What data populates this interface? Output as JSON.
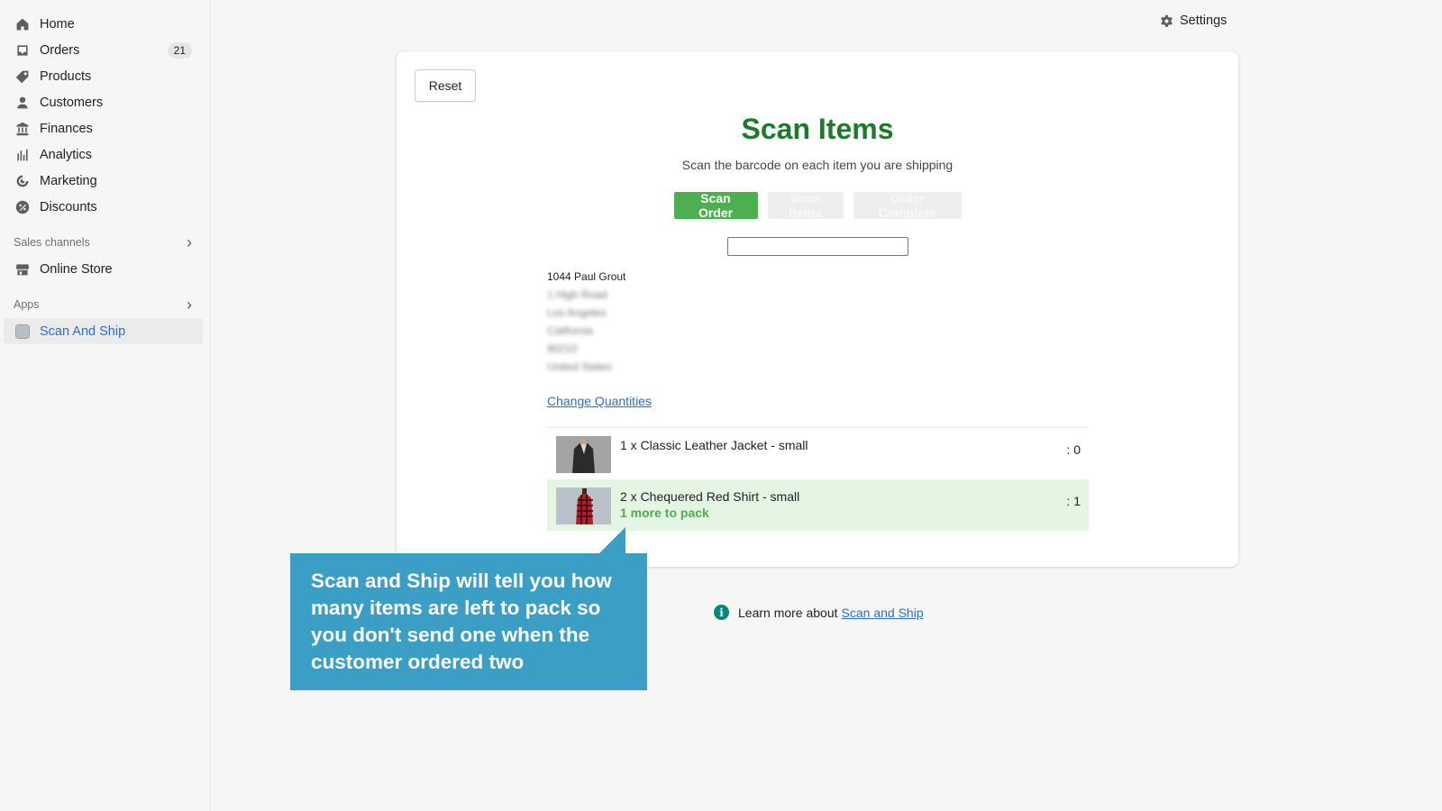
{
  "sidebar": {
    "items": [
      {
        "label": "Home",
        "icon": "home-icon"
      },
      {
        "label": "Orders",
        "icon": "orders-icon",
        "badge": "21"
      },
      {
        "label": "Products",
        "icon": "tag-icon"
      },
      {
        "label": "Customers",
        "icon": "person-icon"
      },
      {
        "label": "Finances",
        "icon": "bank-icon"
      },
      {
        "label": "Analytics",
        "icon": "bar-chart-icon"
      },
      {
        "label": "Marketing",
        "icon": "target-icon"
      },
      {
        "label": "Discounts",
        "icon": "discount-icon"
      }
    ],
    "sales_channels": {
      "heading": "Sales channels",
      "items": [
        {
          "label": "Online Store",
          "icon": "store-icon"
        }
      ]
    },
    "apps": {
      "heading": "Apps",
      "items": [
        {
          "label": "Scan And Ship",
          "icon": "app-icon"
        }
      ]
    }
  },
  "header": {
    "settings_label": "Settings"
  },
  "card": {
    "reset_label": "Reset",
    "title": "Scan Items",
    "subtitle": "Scan the barcode on each item you are shipping",
    "steps": [
      {
        "label": "Scan Order",
        "state": "active"
      },
      {
        "label": "Scan Items",
        "state": "inactive"
      },
      {
        "label": "Order Complete",
        "state": "inactive"
      }
    ],
    "scan_input": {
      "value": "",
      "placeholder": ""
    },
    "address": {
      "name": "1044 Paul Grout",
      "lines": [
        "1 High Road",
        "Los Angeles",
        "California",
        "90210",
        "United States"
      ]
    },
    "change_quantities_label": "Change Quantities",
    "items": [
      {
        "description": "1 x Classic Leather Jacket - small",
        "count": ": 0",
        "status": ""
      },
      {
        "description": "2 x Chequered Red Shirt - small",
        "count": ": 1",
        "status": "1 more to pack"
      }
    ]
  },
  "callout": {
    "text": "Scan and Ship will tell you how many items are left to pack so you don't send one when the customer ordered two"
  },
  "footer": {
    "learn_prefix": "Learn more about",
    "learn_link": "Scan and Ship"
  },
  "colors": {
    "title_green": "#1a7c2a",
    "step_active": "#4caf50",
    "callout_blue": "#3a9ec5",
    "link_blue": "#2c6ecb",
    "info_teal": "#00897b"
  }
}
